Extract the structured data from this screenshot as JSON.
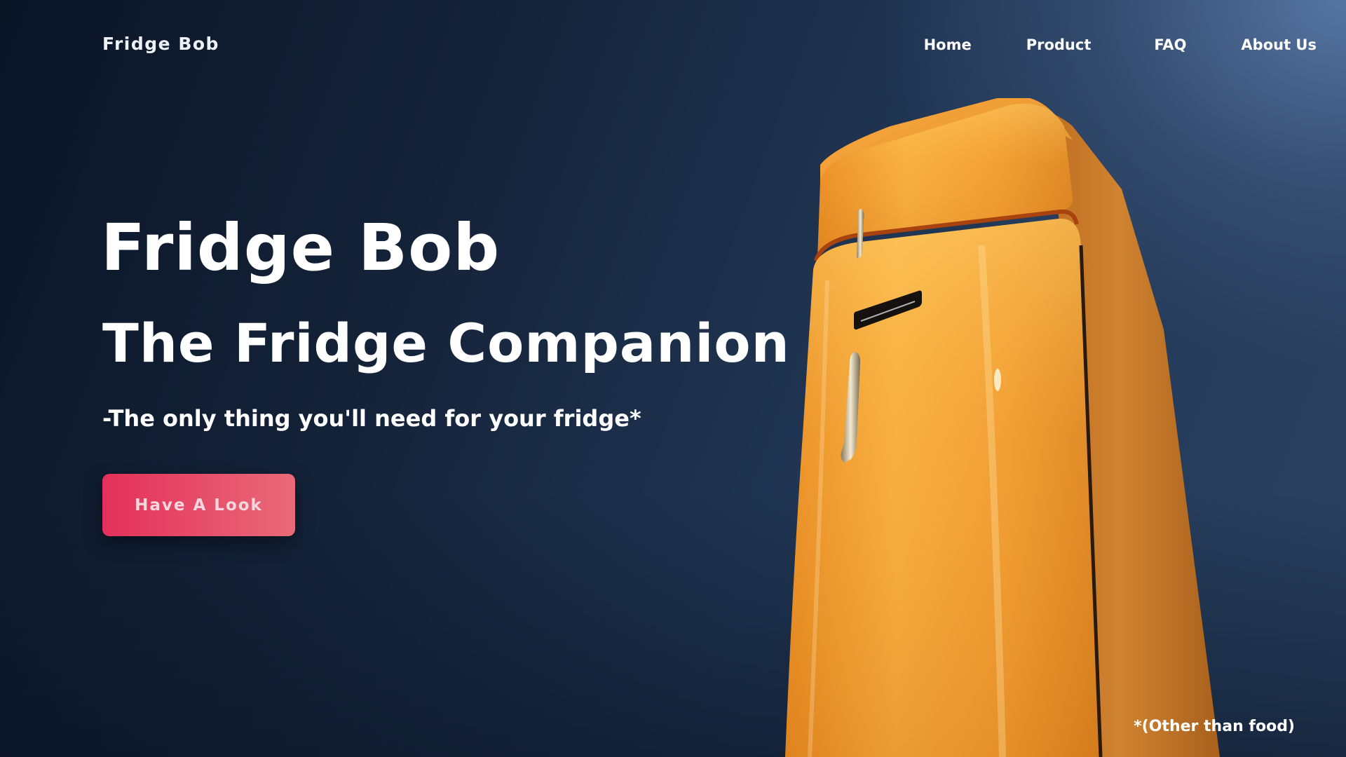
{
  "brand": "Fridge Bob",
  "nav": {
    "home": "Home",
    "product": "Product",
    "faq": "FAQ",
    "about": "About Us"
  },
  "hero": {
    "title": "Fridge Bob",
    "subtitle": "The Fridge Companion",
    "tagline": "-The only thing you'll need for your fridge*",
    "cta_label": "Have A Look"
  },
  "footnote": "*(Other than food)",
  "colors": {
    "background_dark": "#0a1526",
    "background_light": "#5878a6",
    "cta_start": "#e4305b",
    "cta_end": "#e86a78",
    "fridge_orange": "#f0962e"
  },
  "image": {
    "subject": "orange-retro-refrigerator"
  }
}
